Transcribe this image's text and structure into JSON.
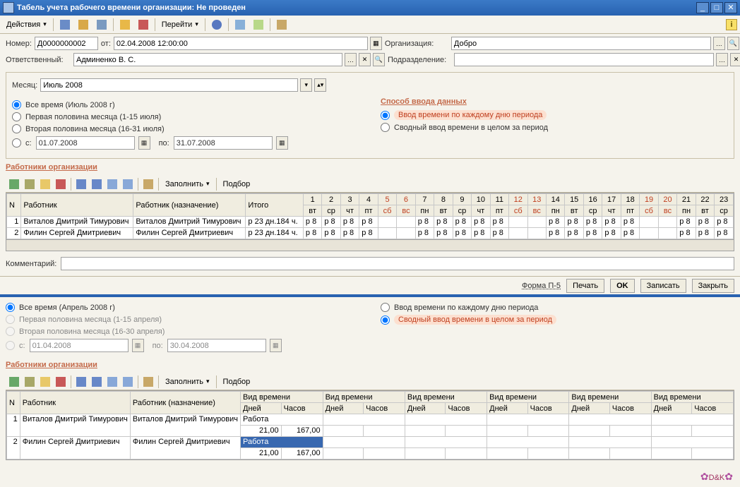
{
  "titlebar": {
    "text": "Табель учета рабочего времени организации: Не проведен"
  },
  "toolbar": {
    "actions": "Действия",
    "goto": "Перейти",
    "help": "?"
  },
  "fields": {
    "number_label": "Номер:",
    "number": "Д0000000002",
    "ot": "от:",
    "date": "02.04.2008 12:00:00",
    "org_label": "Организация:",
    "org": "Добро",
    "resp_label": "Ответственный:",
    "resp": "Админенко В. С.",
    "subdiv_label": "Подразделение:",
    "month_label": "Месяц:",
    "month": "Июль 2008",
    "c_label": "с:",
    "po_label": "по:",
    "date_from": "01.07.2008",
    "date_to": "31.07.2008"
  },
  "radio": {
    "all_time": "Все время (Июль 2008 г)",
    "first_half": "Первая половина месяца (1-15 июля)",
    "second_half": "Вторая половина месяца (16-31 июля)",
    "input_title": "Способ ввода данных",
    "by_day": "Ввод времени по каждому дню периода",
    "summary": "Сводный ввод времени в целом за период"
  },
  "workers_title": "Работники организации",
  "tbl_toolbar": {
    "fill": "Заполнить",
    "select": "Подбор"
  },
  "grid_a": {
    "headers": {
      "n": "N",
      "worker": "Работник",
      "worker_assign": "Работник (назначение)",
      "total": "Итого"
    },
    "days": [
      {
        "n": "1",
        "d": "вт"
      },
      {
        "n": "2",
        "d": "ср"
      },
      {
        "n": "3",
        "d": "чт"
      },
      {
        "n": "4",
        "d": "пт"
      },
      {
        "n": "5",
        "d": "сб",
        "w": true
      },
      {
        "n": "6",
        "d": "вс",
        "w": true
      },
      {
        "n": "7",
        "d": "пн"
      },
      {
        "n": "8",
        "d": "вт"
      },
      {
        "n": "9",
        "d": "ср"
      },
      {
        "n": "10",
        "d": "чт"
      },
      {
        "n": "11",
        "d": "пт"
      },
      {
        "n": "12",
        "d": "сб",
        "w": true
      },
      {
        "n": "13",
        "d": "вс",
        "w": true
      },
      {
        "n": "14",
        "d": "пн"
      },
      {
        "n": "15",
        "d": "вт"
      },
      {
        "n": "16",
        "d": "ср"
      },
      {
        "n": "17",
        "d": "чт"
      },
      {
        "n": "18",
        "d": "пт"
      },
      {
        "n": "19",
        "d": "сб",
        "w": true
      },
      {
        "n": "20",
        "d": "вс",
        "w": true
      },
      {
        "n": "21",
        "d": "пн"
      },
      {
        "n": "22",
        "d": "вт"
      },
      {
        "n": "23",
        "d": "ср"
      }
    ],
    "rows": [
      {
        "n": "1",
        "worker": "Виталов Дмитрий Тимурович",
        "worker2": "Виталов Дмитрий Тимурович",
        "total": "р 23 дн.184 ч.",
        "cells": [
          "р 8",
          "р 8",
          "р 8",
          "р 8",
          "",
          "",
          "р 8",
          "р 8",
          "р 8",
          "р 8",
          "р 8",
          "",
          "",
          "р 8",
          "р 8",
          "р 8",
          "р 8",
          "р 8",
          "",
          "",
          "р 8",
          "р 8",
          "р 8"
        ]
      },
      {
        "n": "2",
        "worker": "Филин Сергей Дмитриевич",
        "worker2": "Филин Сергей Дмитриевич",
        "total": "р 23 дн.184 ч.",
        "cells": [
          "р 8",
          "р 8",
          "р 8",
          "р 8",
          "",
          "",
          "р 8",
          "р 8",
          "р 8",
          "р 8",
          "р 8",
          "",
          "",
          "р 8",
          "р 8",
          "р 8",
          "р 8",
          "р 8",
          "",
          "",
          "р 8",
          "р 8",
          "р 8"
        ]
      }
    ]
  },
  "comment_label": "Комментарий:",
  "footer": {
    "form": "Форма П-5",
    "print": "Печать",
    "ok": "OK",
    "save": "Записать",
    "close": "Закрыть"
  },
  "form2": {
    "all_time": "Все время (Апрель 2008 г)",
    "first_half": "Первая половина месяца (1-15 апреля)",
    "second_half": "Вторая половина месяца (16-30 апреля)",
    "by_day": "Ввод времени по каждому дню периода",
    "summary": "Сводный ввод времени в целом за период",
    "date_from": "01.04.2008",
    "date_to": "30.04.2008"
  },
  "grid_b": {
    "headers": {
      "n": "N",
      "worker": "Работник",
      "worker_assign": "Работник (назначение)",
      "type": "Вид времени",
      "days": "Дней",
      "hours": "Часов"
    },
    "rows": [
      {
        "n": "1",
        "worker": "Виталов Дмитрий Тимурович",
        "worker2": "Виталов Дмитрий Тимурович",
        "type": "Работа",
        "days": "21,00",
        "hours": "167,00"
      },
      {
        "n": "2",
        "worker": "Филин Сергей Дмитриевич",
        "worker2": "Филин Сергей Дмитриевич",
        "type": "Работа",
        "days": "21,00",
        "hours": "167,00"
      }
    ]
  },
  "logo": "D&K"
}
